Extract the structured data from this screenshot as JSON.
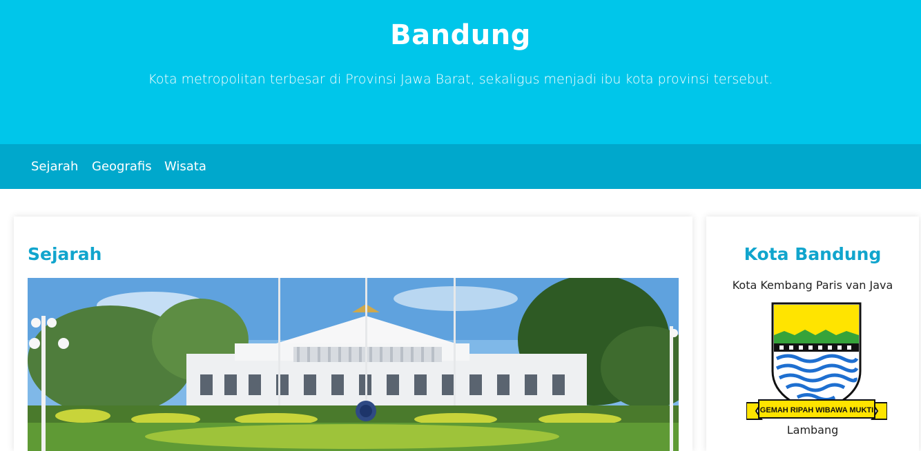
{
  "header": {
    "title": "Bandung",
    "subtitle": "Kota metropolitan terbesar di Provinsi Jawa Barat, sekaligus menjadi ibu kota provinsi tersebut."
  },
  "nav": {
    "items": [
      {
        "label": "Sejarah"
      },
      {
        "label": "Geografis"
      },
      {
        "label": "Wisata"
      }
    ]
  },
  "main": {
    "section_title": "Sejarah"
  },
  "sidebar": {
    "title": "Kota Bandung",
    "subtitle": "Kota Kembang Paris van Java",
    "emblem_motto": "GEMAH RIPAH WIBAWA MUKTI",
    "caption": "Lambang"
  },
  "colors": {
    "header_bg": "#00c6ea",
    "nav_bg": "#00a8cc",
    "accent": "#11a5cd"
  }
}
